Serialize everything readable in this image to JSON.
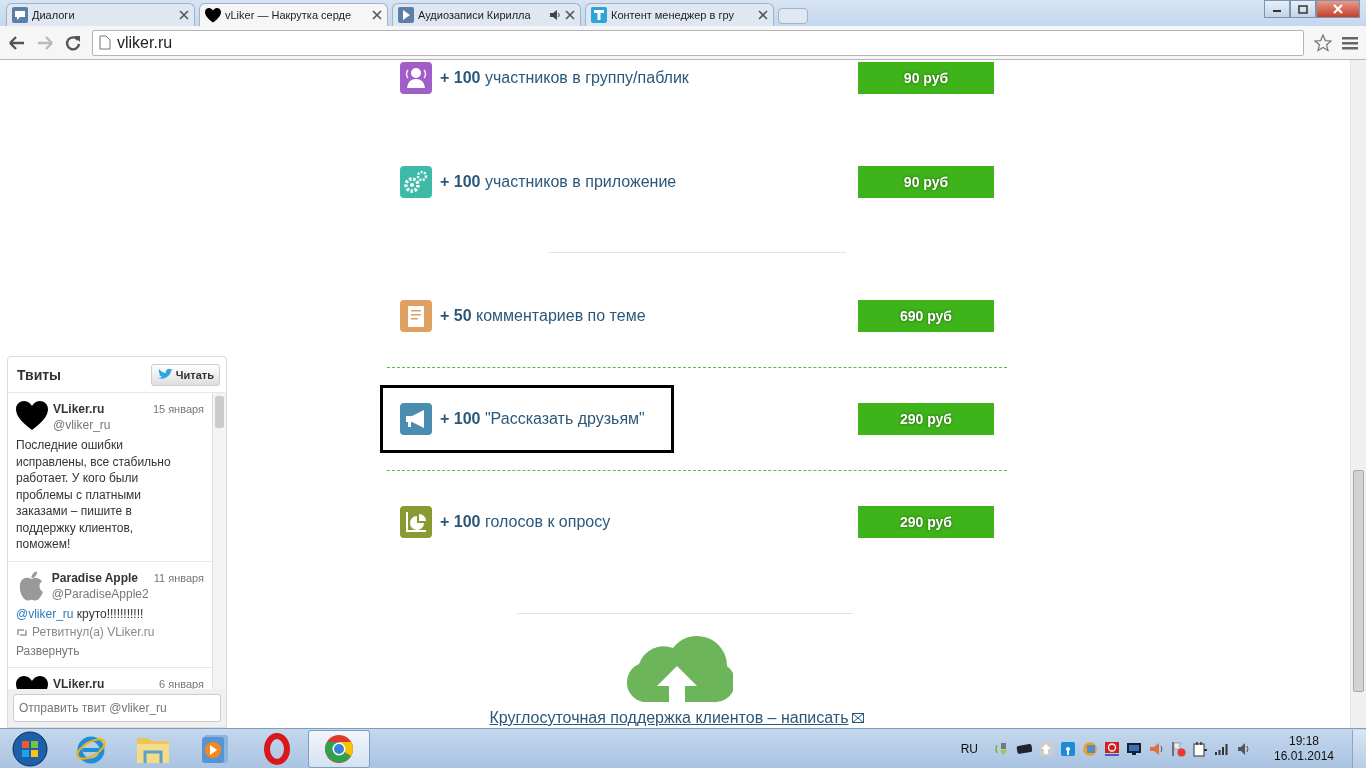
{
  "browser": {
    "tabs": [
      {
        "title": "Диалоги",
        "selected": false,
        "audio": false
      },
      {
        "title": "vLiker — Накрутка серде",
        "selected": true,
        "audio": false
      },
      {
        "title": "Аудиозаписи Кирилла",
        "selected": false,
        "audio": true
      },
      {
        "title": "Контент менеджер в гру",
        "selected": false,
        "audio": false
      }
    ],
    "address": "vliker.ru"
  },
  "services": [
    {
      "kind": "service",
      "text": "**+ 100** участников в группу/паблик",
      "price": "90 руб",
      "highlighted": false
    },
    {
      "kind": "service",
      "text": "**+ 100** участников в приложение",
      "price": "90 руб",
      "highlighted": false
    },
    {
      "kind": "short-rule"
    },
    {
      "kind": "service",
      "text": "**+ 50** комментариев по теме",
      "price": "690 руб",
      "highlighted": false
    },
    {
      "kind": "dashed-rule"
    },
    {
      "kind": "service",
      "text": "**+ 100** \"Рассказать друзьям\"",
      "price": "290 руб",
      "highlighted": true
    },
    {
      "kind": "dashed-rule"
    },
    {
      "kind": "service",
      "text": "**+ 100** голосов к опросу",
      "price": "290 руб",
      "highlighted": false
    },
    {
      "kind": "wide-rule"
    }
  ],
  "support": {
    "text": "Круглосуточная поддержка клиентов – написать"
  },
  "twitter": {
    "title": "Твиты",
    "follow_button": "Читать",
    "tweets": [
      {
        "name": "VLiker.ru",
        "handle": "@vliker_ru",
        "date": "15 января",
        "text": "Последние ошибки исправлены, все стабильно работает. У кого были проблемы с платными заказами – пишите в поддержку клиентов, поможем!"
      },
      {
        "name": "Paradise Apple",
        "handle": "@ParadiseApple2",
        "date": "11 января",
        "mention": "@vliker_ru",
        "text": "круто!!!!!!!!!!!",
        "retweet": "Ретвитнул(а) VLiker.ru",
        "expand": "Развернуть"
      },
      {
        "name": "VLiker.ru",
        "date": "6 января"
      }
    ],
    "composer_placeholder": "Отправить твит @vliker_ru"
  },
  "taskbar": {
    "apps": [
      {
        "kind": "browser-e",
        "active": false
      },
      {
        "kind": "folder",
        "active": false
      },
      {
        "kind": "media",
        "active": false
      },
      {
        "kind": "opera",
        "active": false
      },
      {
        "kind": "chrome",
        "active": true
      }
    ],
    "language": "RU",
    "time": "19:18",
    "date": "16.01.2014"
  }
}
